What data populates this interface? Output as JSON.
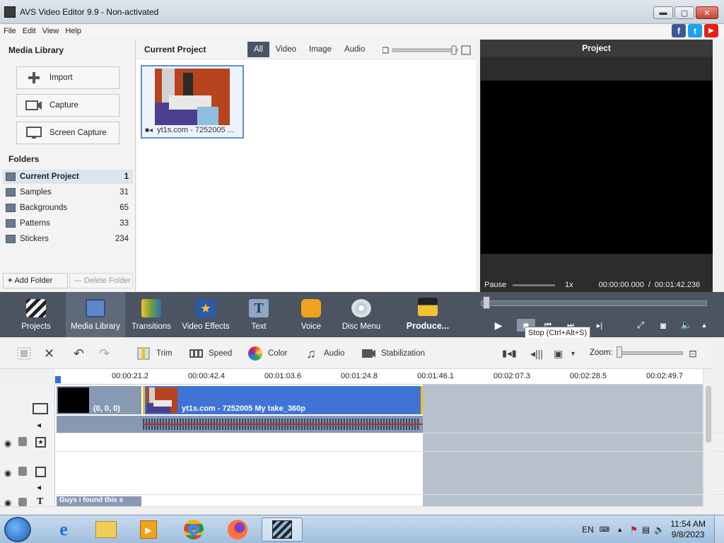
{
  "window": {
    "title": "AVS Video Editor 9.9 - Non-activated"
  },
  "menu": [
    "File",
    "Edit",
    "View",
    "Help"
  ],
  "social": [
    "f",
    "t",
    "▶"
  ],
  "media_library": {
    "title": "Media Library",
    "buttons": [
      "Import",
      "Capture",
      "Screen Capture"
    ],
    "folders_title": "Folders",
    "folders": [
      {
        "name": "Current Project",
        "count": "1"
      },
      {
        "name": "Samples",
        "count": "31"
      },
      {
        "name": "Backgrounds",
        "count": "65"
      },
      {
        "name": "Patterns",
        "count": "33"
      },
      {
        "name": "Stickers",
        "count": "234"
      }
    ],
    "add_folder": "Add Folder",
    "delete_folder": "Delete Folder"
  },
  "current_project": {
    "title": "Current Project",
    "filters": [
      "All",
      "Video",
      "Image",
      "Audio"
    ],
    "item_caption": "yt1s.com - 7252005 ..."
  },
  "preview": {
    "title": "Project",
    "status": "Pause",
    "speed": "1x",
    "time_current": "00:00:00.000",
    "time_separator": "/",
    "time_total": "00:01:42.236",
    "tooltip": "Stop (Ctrl+Alt+S)"
  },
  "tools": [
    "Projects",
    "Media Library",
    "Transitions",
    "Video Effects",
    "Text",
    "Voice",
    "Disc Menu",
    "Produce..."
  ],
  "edit_toolbar": {
    "trim": "Trim",
    "speed": "Speed",
    "color": "Color",
    "audio": "Audio",
    "stabilization": "Stabilization",
    "zoom": "Zoom:"
  },
  "timeline": {
    "ticks": [
      "00:00:21.2",
      "00:00:42.4",
      "00:01:03.6",
      "00:01:24.8",
      "00:01:46.1",
      "00:02:07.3",
      "00:02:28.5",
      "00:02:49.7"
    ],
    "black_clip_label": "(0, 0, 0)",
    "main_clip_label": "yt1s.com - 7252005 My take_360p",
    "text_clip_label": "Guys i found this s"
  },
  "taskbar": {
    "lang": "EN",
    "time": "11:54 AM",
    "date": "9/8/2023"
  },
  "colors": {
    "accent_blue": "#3f74d6",
    "dark_toolbar": "#4c5461",
    "clip_border": "#e8c317",
    "audio_line": "#d61f1f"
  }
}
